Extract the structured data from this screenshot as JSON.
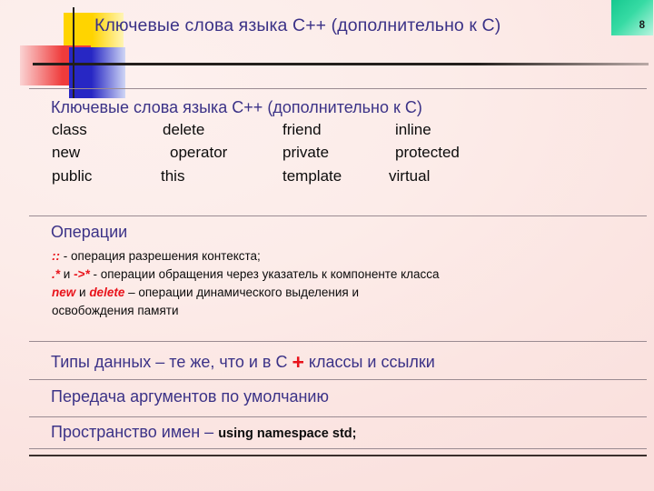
{
  "slide": {
    "page_number": "8",
    "header_title": "Ключевые слова языка C++ (дополнительно к C)",
    "section_title": "Ключевые слова языка C++ (дополнительно к C)",
    "colors": {
      "heading_blue": "#3b3287",
      "highlight_red": "#e8131b",
      "body_black": "#0c0c0c",
      "badge_green": "#16c88f",
      "background": "#fcece9",
      "rule": "#9a8b92"
    }
  },
  "keywords": {
    "rows": [
      [
        "class",
        "delete",
        "friend",
        "inline"
      ],
      [
        "new",
        "operator",
        "private",
        "protected"
      ],
      [
        "public",
        "this",
        "template",
        "virtual"
      ]
    ]
  },
  "operations": {
    "title": "Операции",
    "lines": [
      {
        "pre": "",
        "code1": "::",
        "mid": "",
        "code2": "",
        "post": "  - операция разрешения контекста;"
      },
      {
        "pre": "",
        "code1": ".*",
        "mid": " и ",
        "code2": "->*",
        "post": " - операции обращения через указатель к компоненте класса"
      },
      {
        "pre": "",
        "code1": "new",
        "mid": " и ",
        "code2": "delete",
        "post": " – операции динамического выделения и"
      },
      {
        "pre": "",
        "code1": "",
        "mid": "",
        "code2": "",
        "post": "освобождения памяти"
      }
    ]
  },
  "datatypes": {
    "before_plus": "Типы данных – те же, что и в C ",
    "plus": "+",
    "after_plus": " классы и ссылки"
  },
  "defaults": {
    "text": "Передача аргументов по умолчанию"
  },
  "namespace": {
    "label": "Пространство имен – ",
    "code": "using namespace std;"
  }
}
